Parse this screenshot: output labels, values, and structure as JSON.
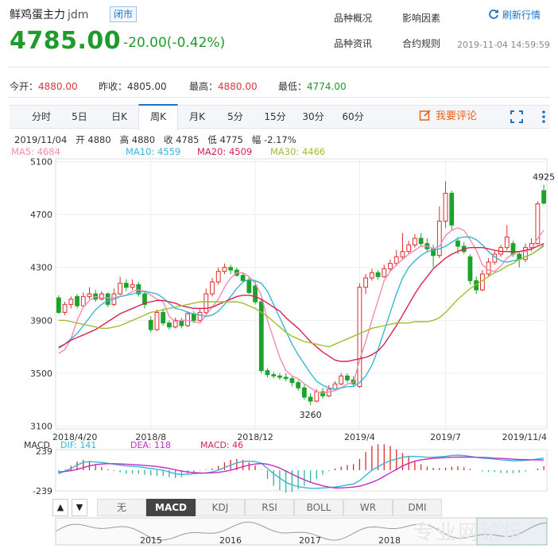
{
  "header": {
    "title": "鲜鸡蛋主力",
    "code": "jdm",
    "status": "闭市",
    "price": "4785.00",
    "change": "-20.00(-0.42%)",
    "links": [
      "品种概况",
      "影响因素",
      "品种资讯",
      "合约规则"
    ],
    "refresh": "刷新行情",
    "timestamp": "2019-11-04 14:59:59"
  },
  "stats": {
    "open_label": "今开：",
    "open": "4880.00",
    "prev_label": "昨收：",
    "prev": "4805.00",
    "high_label": "最高：",
    "high": "4880.00",
    "low_label": "最低：",
    "low": "4774.00"
  },
  "tabs": [
    "分时",
    "5日",
    "日K",
    "周K",
    "月K",
    "5分",
    "15分",
    "30分",
    "60分"
  ],
  "active_tab": "周K",
  "comment": "我要评论",
  "info_line": "2019/11/04   开 4880   高 4880   收 4785   低 4775   幅 -2.17%",
  "ma_labels": [
    {
      "text": "MA5: 4684",
      "color": "#f28cb1"
    },
    {
      "text": "MA10: 4559",
      "color": "#36b6d8"
    },
    {
      "text": "MA20: 4509",
      "color": "#d9234f"
    },
    {
      "text": "MA30: 4466",
      "color": "#9dbf2e"
    }
  ],
  "macd_labels": [
    {
      "text": "MACD",
      "color": "#333333"
    },
    {
      "text": "DIF: 141",
      "color": "#36b6d8"
    },
    {
      "text": "DEA: 118",
      "color": "#c02fc0"
    },
    {
      "text": "MACD: 46",
      "color": "#d9234f"
    }
  ],
  "indicator_buttons": [
    "无",
    "MACD",
    "KDJ",
    "RSI",
    "BOLL",
    "WR",
    "DMI"
  ],
  "active_indicator": "MACD",
  "nav_arrows": [
    "▲",
    "▼"
  ],
  "watermark": "专业网论坛",
  "colors": {
    "up": "#e02b2b",
    "down": "#1ca32a",
    "accent": "#1a73c7"
  },
  "chart_data": {
    "type": "candlestick",
    "title": "",
    "yticks": [
      5100,
      4700,
      4300,
      3900,
      3500,
      3100
    ],
    "ylim": [
      3080,
      5120
    ],
    "xtick_labels": [
      {
        "label": "2018/4/20",
        "index": 0
      },
      {
        "label": "2018/8",
        "index": 15
      },
      {
        "label": "2018/12",
        "index": 32
      },
      {
        "label": "2019/4",
        "index": 49
      },
      {
        "label": "2019/7",
        "index": 63
      },
      {
        "label": "2019/11/4",
        "index": 79
      }
    ],
    "annotations": [
      {
        "text": "4925",
        "index": 79,
        "value": 4925
      },
      {
        "text": "3260",
        "index": 41,
        "value": 3260
      }
    ],
    "candles": [
      [
        4070,
        3960,
        4090,
        3950
      ],
      [
        3960,
        4020,
        4040,
        3940
      ],
      [
        4020,
        4060,
        4080,
        3990
      ],
      [
        4080,
        4010,
        4100,
        3990
      ],
      [
        4010,
        4080,
        4110,
        4000
      ],
      [
        4080,
        4100,
        4150,
        4060
      ],
      [
        4100,
        4060,
        4130,
        4040
      ],
      [
        4060,
        4100,
        4120,
        4050
      ],
      [
        4100,
        4020,
        4110,
        4000
      ],
      [
        4020,
        4100,
        4140,
        4010
      ],
      [
        4100,
        4180,
        4230,
        4090
      ],
      [
        4180,
        4150,
        4210,
        4120
      ],
      [
        4150,
        4170,
        4210,
        4130
      ],
      [
        4170,
        4100,
        4190,
        4080
      ],
      [
        4100,
        4020,
        4120,
        3990
      ],
      [
        3900,
        3830,
        3930,
        3810
      ],
      [
        3830,
        3960,
        3980,
        3820
      ],
      [
        3960,
        3880,
        3990,
        3860
      ],
      [
        3880,
        3850,
        3900,
        3830
      ],
      [
        3850,
        3900,
        3920,
        3840
      ],
      [
        3900,
        3860,
        3920,
        3840
      ],
      [
        3860,
        3950,
        3970,
        3850
      ],
      [
        3950,
        3900,
        3970,
        3880
      ],
      [
        3900,
        3960,
        3990,
        3890
      ],
      [
        3960,
        4100,
        4140,
        3950
      ],
      [
        4100,
        4190,
        4220,
        4080
      ],
      [
        4190,
        4270,
        4300,
        4170
      ],
      [
        4270,
        4300,
        4330,
        4250
      ],
      [
        4300,
        4280,
        4320,
        4250
      ],
      [
        4280,
        4240,
        4300,
        4230
      ],
      [
        4240,
        4200,
        4260,
        4190
      ],
      [
        4200,
        4110,
        4230,
        4100
      ],
      [
        4160,
        4040,
        4200,
        4020
      ],
      [
        4040,
        3520,
        4060,
        3500
      ],
      [
        3520,
        3490,
        3540,
        3470
      ],
      [
        3490,
        3480,
        3510,
        3460
      ],
      [
        3480,
        3470,
        3500,
        3450
      ],
      [
        3470,
        3460,
        3500,
        3440
      ],
      [
        3460,
        3430,
        3480,
        3400
      ],
      [
        3430,
        3390,
        3450,
        3370
      ],
      [
        3390,
        3320,
        3420,
        3300
      ],
      [
        3320,
        3290,
        3350,
        3260
      ],
      [
        3290,
        3360,
        3380,
        3280
      ],
      [
        3360,
        3330,
        3390,
        3310
      ],
      [
        3330,
        3380,
        3410,
        3320
      ],
      [
        3380,
        3420,
        3440,
        3370
      ],
      [
        3420,
        3480,
        3500,
        3410
      ],
      [
        3480,
        3450,
        3500,
        3430
      ],
      [
        3450,
        3420,
        3480,
        3400
      ],
      [
        3400,
        4150,
        4180,
        3390
      ],
      [
        4150,
        4220,
        4250,
        4100
      ],
      [
        4220,
        4260,
        4290,
        4200
      ],
      [
        4260,
        4230,
        4280,
        4210
      ],
      [
        4230,
        4290,
        4320,
        4220
      ],
      [
        4290,
        4330,
        4360,
        4270
      ],
      [
        4330,
        4380,
        4430,
        4310
      ],
      [
        4380,
        4420,
        4560,
        4360
      ],
      [
        4420,
        4470,
        4500,
        4400
      ],
      [
        4470,
        4520,
        4550,
        4450
      ],
      [
        4520,
        4480,
        4560,
        4460
      ],
      [
        4480,
        4440,
        4520,
        4420
      ],
      [
        4440,
        4390,
        4470,
        4300
      ],
      [
        4390,
        4650,
        4760,
        4370
      ],
      [
        4650,
        4860,
        4950,
        4600
      ],
      [
        4860,
        4620,
        4880,
        4580
      ],
      [
        4500,
        4460,
        4530,
        4400
      ],
      [
        4460,
        4420,
        4490,
        4400
      ],
      [
        4380,
        4200,
        4400,
        4170
      ],
      [
        4200,
        4130,
        4230,
        4100
      ],
      [
        4130,
        4250,
        4280,
        4120
      ],
      [
        4250,
        4340,
        4370,
        4230
      ],
      [
        4340,
        4400,
        4430,
        4320
      ],
      [
        4400,
        4450,
        4470,
        4380
      ],
      [
        4450,
        4530,
        4620,
        4430
      ],
      [
        4480,
        4400,
        4500,
        4380
      ],
      [
        4400,
        4360,
        4420,
        4300
      ],
      [
        4360,
        4450,
        4480,
        4340
      ],
      [
        4450,
        4480,
        4520,
        4420
      ],
      [
        4480,
        4780,
        4800,
        4470
      ],
      [
        4880,
        4785,
        4925,
        4775
      ]
    ],
    "ma_series": [
      {
        "name": "MA5",
        "color": "#f28cb1",
        "values": [
          3650,
          3680,
          3760,
          3900,
          4000,
          4050,
          4080,
          4070,
          4070,
          4070,
          4080,
          4090,
          4120,
          4130,
          4120,
          4090,
          4060,
          4040,
          3930,
          3890,
          3900,
          3900,
          3890,
          3880,
          3940,
          4000,
          4060,
          4150,
          4220,
          4260,
          4260,
          4230,
          4180,
          4090,
          3900,
          3760,
          3620,
          3520,
          3480,
          3460,
          3420,
          3390,
          3360,
          3350,
          3360,
          3370,
          3390,
          3420,
          3430,
          3600,
          3740,
          3900,
          4050,
          4200,
          4270,
          4320,
          4360,
          4400,
          4430,
          4460,
          4460,
          4440,
          4460,
          4540,
          4580,
          4600,
          4580,
          4510,
          4430,
          4320,
          4280,
          4270,
          4310,
          4370,
          4400,
          4420,
          4420,
          4440,
          4520,
          4580
        ]
      },
      {
        "name": "MA10",
        "color": "#36b6d8",
        "values": [
          3700,
          3720,
          3760,
          3800,
          3860,
          3920,
          3980,
          4020,
          4050,
          4060,
          4080,
          4090,
          4100,
          4110,
          4120,
          4110,
          4100,
          4070,
          4030,
          3990,
          3980,
          3960,
          3950,
          3940,
          3930,
          3940,
          3970,
          4020,
          4080,
          4140,
          4190,
          4210,
          4200,
          4180,
          4120,
          4020,
          3920,
          3820,
          3720,
          3640,
          3570,
          3500,
          3440,
          3410,
          3390,
          3380,
          3390,
          3400,
          3400,
          3430,
          3480,
          3560,
          3680,
          3820,
          3960,
          4100,
          4220,
          4300,
          4350,
          4390,
          4420,
          4430,
          4440,
          4460,
          4490,
          4520,
          4530,
          4530,
          4510,
          4470,
          4420,
          4380,
          4350,
          4340,
          4350,
          4360,
          4380,
          4400,
          4430,
          4470
        ]
      },
      {
        "name": "MA20",
        "color": "#d9234f",
        "values": [
          3690,
          3720,
          3750,
          3770,
          3790,
          3810,
          3830,
          3860,
          3890,
          3920,
          3950,
          3970,
          3990,
          4010,
          4030,
          4040,
          4050,
          4050,
          4040,
          4030,
          4010,
          4000,
          3990,
          3990,
          3990,
          4000,
          4020,
          4040,
          4060,
          4080,
          4090,
          4090,
          4080,
          4060,
          4030,
          4000,
          3970,
          3920,
          3880,
          3840,
          3790,
          3740,
          3700,
          3660,
          3630,
          3600,
          3590,
          3590,
          3600,
          3610,
          3620,
          3640,
          3670,
          3720,
          3790,
          3860,
          3940,
          4020,
          4100,
          4170,
          4230,
          4290,
          4330,
          4370,
          4400,
          4420,
          4440,
          4450,
          4450,
          4450,
          4440,
          4430,
          4420,
          4420,
          4420,
          4420,
          4430,
          4440,
          4460,
          4480
        ]
      },
      {
        "name": "MA30",
        "color": "#9dbf2e",
        "values": [
          3900,
          3900,
          3890,
          3880,
          3870,
          3860,
          3850,
          3840,
          3840,
          3850,
          3860,
          3880,
          3900,
          3920,
          3940,
          3960,
          3970,
          3980,
          3990,
          4000,
          4010,
          4020,
          4030,
          4040,
          4040,
          4040,
          4040,
          4040,
          4040,
          4040,
          4030,
          4010,
          3990,
          3960,
          3930,
          3890,
          3850,
          3810,
          3780,
          3760,
          3740,
          3730,
          3720,
          3710,
          3700,
          3720,
          3740,
          3760,
          3780,
          3800,
          3820,
          3840,
          3850,
          3860,
          3870,
          3880,
          3880,
          3880,
          3890,
          3890,
          3890,
          3900,
          3920,
          3960,
          4010,
          4060,
          4100,
          4140,
          4170,
          4200,
          4230,
          4260,
          4280,
          4310,
          4330,
          4360,
          4380,
          4400,
          4430,
          4460
        ]
      }
    ],
    "macd": {
      "ylim": [
        -239,
        239
      ],
      "ytick_labels": [
        "239",
        "-239"
      ],
      "dif": [
        -40,
        -10,
        20,
        60,
        90,
        100,
        95,
        90,
        80,
        70,
        60,
        50,
        45,
        40,
        30,
        20,
        10,
        0,
        -20,
        -40,
        -50,
        -45,
        -40,
        -35,
        -30,
        -20,
        0,
        30,
        60,
        85,
        100,
        105,
        100,
        80,
        20,
        -40,
        -90,
        -140,
        -170,
        -190,
        -200,
        -210,
        -210,
        -205,
        -200,
        -195,
        -185,
        -170,
        -160,
        -120,
        -60,
        0,
        40,
        80,
        110,
        130,
        150,
        160,
        160,
        155,
        150,
        150,
        155,
        160,
        170,
        175,
        170,
        160,
        150,
        140,
        135,
        130,
        120,
        115,
        110,
        110,
        115,
        120,
        130,
        141
      ],
      "dea": [
        -20,
        -15,
        -5,
        10,
        30,
        50,
        65,
        72,
        75,
        75,
        73,
        70,
        66,
        62,
        56,
        50,
        42,
        32,
        20,
        5,
        -10,
        -20,
        -28,
        -32,
        -33,
        -30,
        -25,
        -15,
        0,
        20,
        40,
        60,
        72,
        78,
        70,
        50,
        25,
        -10,
        -45,
        -80,
        -110,
        -140,
        -160,
        -180,
        -195,
        -205,
        -205,
        -200,
        -195,
        -185,
        -165,
        -140,
        -110,
        -70,
        -30,
        10,
        50,
        80,
        105,
        120,
        130,
        137,
        142,
        146,
        150,
        152,
        153,
        152,
        150,
        147,
        145,
        140,
        137,
        132,
        128,
        124,
        122,
        120,
        120,
        118
      ],
      "macd": [
        -40,
        5,
        50,
        100,
        120,
        100,
        60,
        36,
        10,
        -10,
        -26,
        -40,
        -42,
        -44,
        -52,
        -60,
        -64,
        -64,
        -80,
        -90,
        -80,
        -50,
        -24,
        -6,
        6,
        20,
        50,
        90,
        120,
        130,
        120,
        90,
        56,
        4,
        -100,
        -180,
        -230,
        -260,
        -250,
        -220,
        -180,
        -140,
        -100,
        -50,
        -10,
        20,
        40,
        60,
        70,
        130,
        210,
        280,
        300,
        300,
        280,
        240,
        200,
        160,
        110,
        70,
        40,
        26,
        26,
        28,
        40,
        46,
        34,
        16,
        0,
        -14,
        -20,
        -20,
        -34,
        -34,
        -36,
        -28,
        -14,
        0,
        20,
        46
      ]
    }
  }
}
